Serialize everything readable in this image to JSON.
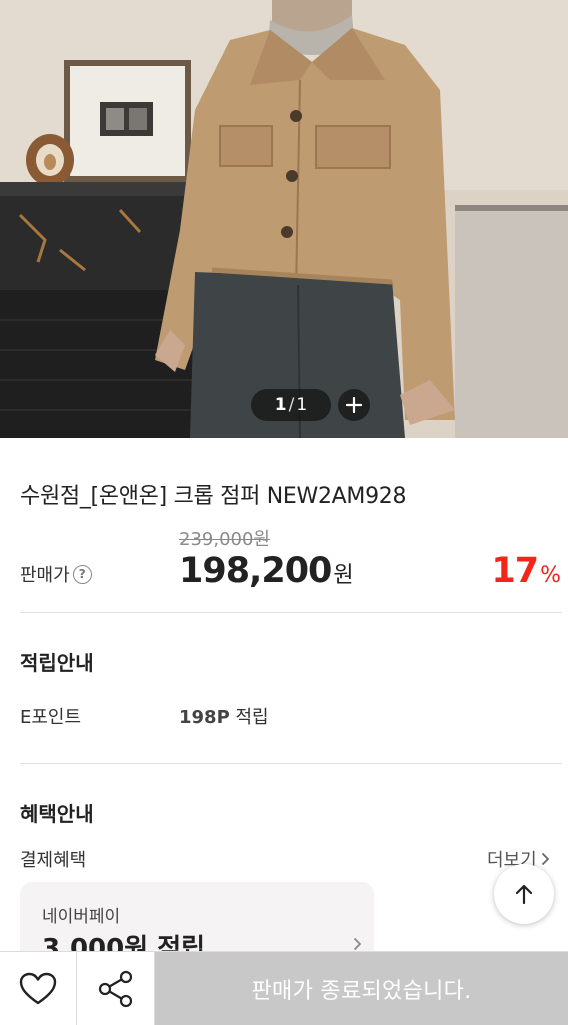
{
  "gallery": {
    "current": "1",
    "separator": "/",
    "total": "1"
  },
  "product": {
    "title": "수원점_[온앤온] 크롭 점퍼 NEW2AM928",
    "original_price": "239,000원",
    "sale_label": "판매가",
    "sale_price": "198,200",
    "currency": "원",
    "discount": "17",
    "discount_unit": "%"
  },
  "points": {
    "section_title": "적립안내",
    "label": "E포인트",
    "value": "198P",
    "value_suffix": " 적립"
  },
  "benefits": {
    "section_title": "혜택안내",
    "payment_label": "결제혜택",
    "more_label": "더보기",
    "card": {
      "name": "네이버페이",
      "amount": "3,000원 적립"
    }
  },
  "bottom_bar": {
    "status_label": "판매가 종료되었습니다."
  },
  "icons": {
    "help": "question-circle-icon",
    "zoom": "plus-icon",
    "more": "chevron-right-icon",
    "scroll_top": "arrow-up-icon",
    "wishlist": "heart-icon",
    "share": "share-icon"
  },
  "colors": {
    "discount": "#f2271a",
    "soldout_bg": "#c8c8c8",
    "card_bg": "#f5f3f4"
  }
}
